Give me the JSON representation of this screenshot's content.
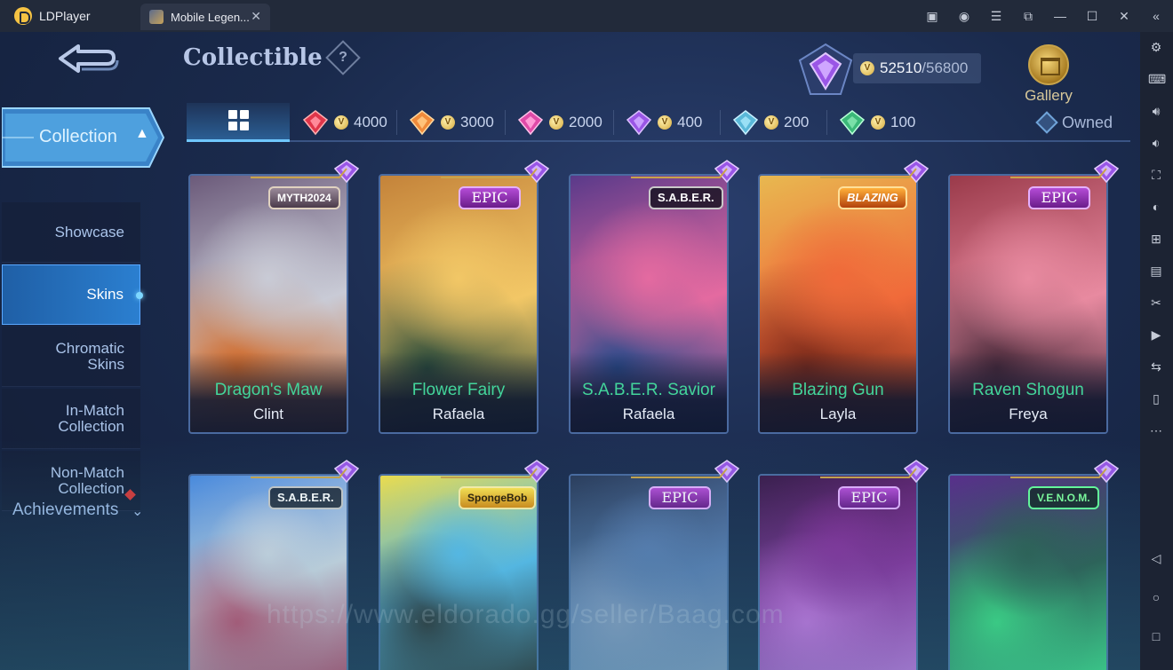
{
  "window": {
    "app_name": "LDPlayer",
    "tab_title": "Mobile Legen...",
    "controls": [
      "store-icon",
      "account-icon",
      "menu-icon",
      "popout-icon",
      "minimize-icon",
      "maximize-icon",
      "close-icon",
      "collapse-sidebar-icon"
    ]
  },
  "header": {
    "title": "Collectible",
    "help_symbol": "?",
    "points_current": "52510",
    "points_max": "/56800",
    "gallery_label": "Gallery"
  },
  "sidebar": {
    "collection_label": "Collection",
    "collection_caret": "▲",
    "items": [
      {
        "label": "Showcase",
        "active": false
      },
      {
        "label": "Skins",
        "active": true
      },
      {
        "label": "Chromatic Skins",
        "active": false
      },
      {
        "label": "In-Match Collection",
        "active": false
      },
      {
        "label": "Non-Match Collection",
        "active": false
      }
    ],
    "achievements_label": "Achievements",
    "achievements_caret": "⌄"
  },
  "filters": {
    "tiers": [
      {
        "value": "4000",
        "color": "#e0354a"
      },
      {
        "value": "3000",
        "color": "#f08a3a"
      },
      {
        "value": "2000",
        "color": "#e04aa8"
      },
      {
        "value": "400",
        "color": "#9a56e6"
      },
      {
        "value": "200",
        "color": "#5ab8d8"
      },
      {
        "value": "100",
        "color": "#3ab878"
      }
    ],
    "owned_label": "Owned"
  },
  "cards": [
    {
      "name": "Dragon's Maw",
      "hero": "Clint",
      "badge": "MYTH2024",
      "badge_style": "myth",
      "art": [
        "#c9cbd6",
        "#6b5a7a",
        "#d06a2a"
      ]
    },
    {
      "name": "Flower Fairy",
      "hero": "Rafaela",
      "badge": "EPIC",
      "badge_style": "epic",
      "art": [
        "#f2c766",
        "#c4833a",
        "#2a4a3a"
      ]
    },
    {
      "name": "S.A.B.E.R. Savior",
      "hero": "Rafaela",
      "badge": "S.A.B.E.R.",
      "badge_style": "logo",
      "art": [
        "#e46aa0",
        "#5a3a8a",
        "#2a4a8a"
      ]
    },
    {
      "name": "Blazing Gun",
      "hero": "Layla",
      "badge": "BLAZING",
      "badge_style": "logo-orange",
      "art": [
        "#f06a3a",
        "#e8b850",
        "#7a2a1a"
      ]
    },
    {
      "name": "Raven Shogun",
      "hero": "Freya",
      "badge": "EPIC",
      "badge_style": "epic",
      "art": [
        "#e88aa0",
        "#9a3a4a",
        "#4a2a3a"
      ]
    },
    {
      "name": "",
      "hero": "",
      "badge": "S.A.B.E.R.",
      "badge_style": "logo",
      "art": [
        "#d6dbe6",
        "#4a8ae0",
        "#c94a6a"
      ]
    },
    {
      "name": "",
      "hero": "",
      "badge": "SpongeBob",
      "badge_style": "logo-yellow",
      "art": [
        "#5ac0f0",
        "#f4e04a",
        "#2a2a2a"
      ]
    },
    {
      "name": "",
      "hero": "",
      "badge": "EPIC",
      "badge_style": "epic",
      "art": [
        "#5a7ab0",
        "#2a3a5a",
        "#8a9ac0"
      ]
    },
    {
      "name": "",
      "hero": "",
      "badge": "EPIC",
      "badge_style": "epic",
      "art": [
        "#8a2a9a",
        "#3a1a4a",
        "#d06ae0"
      ]
    },
    {
      "name": "",
      "hero": "",
      "badge": "V.E.N.O.M.",
      "badge_style": "logo-green",
      "art": [
        "#2a5a4a",
        "#5a2a8a",
        "#3ae07a"
      ]
    }
  ],
  "watermark": "https://www.eldorado.gg/seller/Baag.com",
  "right_toolbar": [
    "settings-icon",
    "keyboard-icon",
    "volume-up-icon",
    "volume-down-icon",
    "fullscreen-icon",
    "record-icon",
    "add-window-icon",
    "apk-icon",
    "cut-icon",
    "video-icon",
    "sync-icon",
    "shake-icon",
    "more-icon",
    "back-nav-icon",
    "home-nav-icon",
    "recent-nav-icon"
  ]
}
